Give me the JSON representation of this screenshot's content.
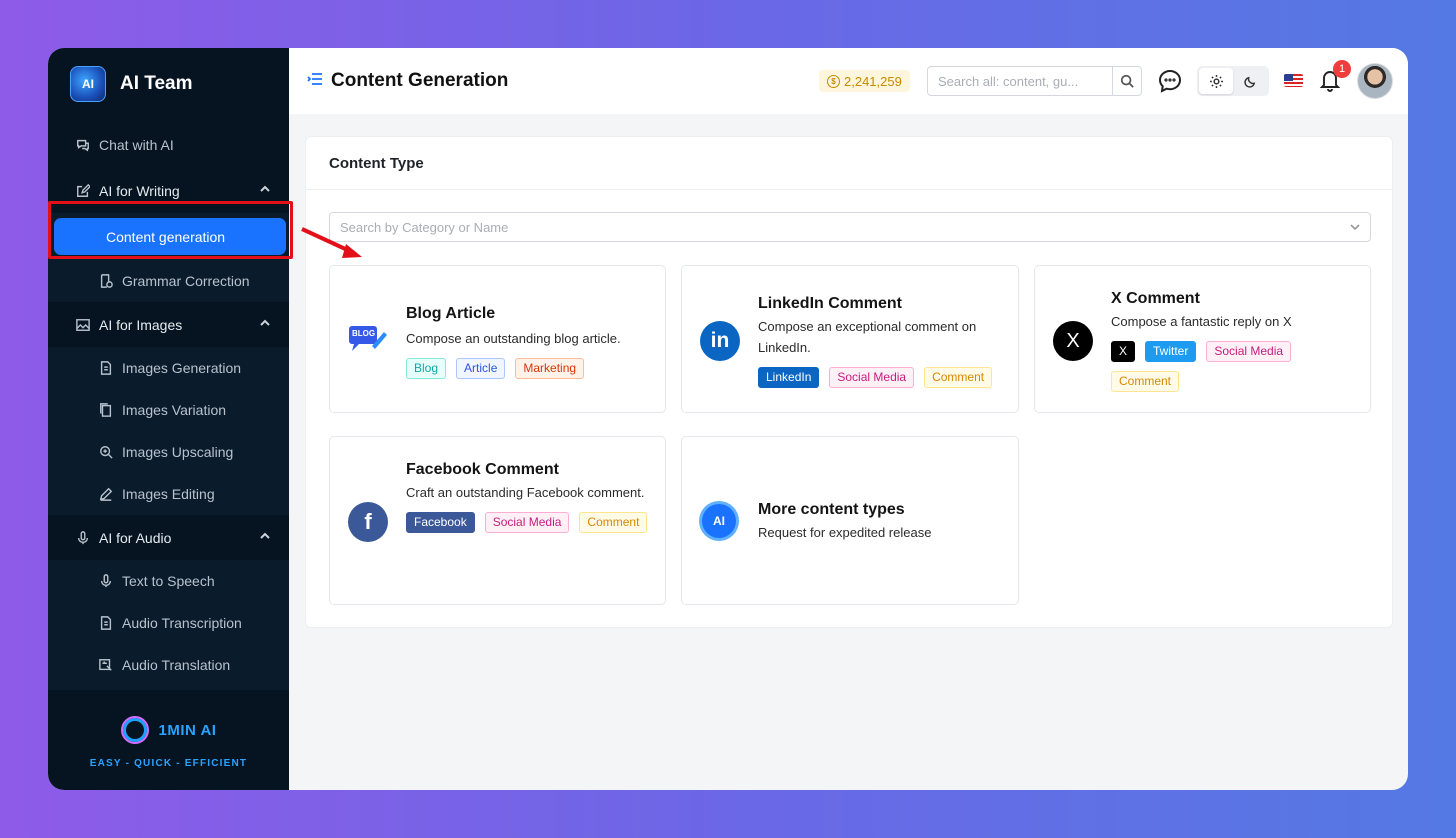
{
  "app": {
    "name": "AI Team",
    "logo_text": "AI"
  },
  "sidebar": {
    "items": [
      {
        "label": "Chat with AI",
        "icon": "chat-bubbles-icon"
      },
      {
        "label": "AI for Writing",
        "icon": "edit-icon",
        "group": true
      },
      {
        "label": "Content generation",
        "icon": "document-icon",
        "active": true
      },
      {
        "label": "Grammar Correction",
        "icon": "grammar-icon"
      },
      {
        "label": "AI for Images",
        "icon": "image-icon",
        "group": true
      },
      {
        "label": "Images Generation",
        "icon": "document-icon"
      },
      {
        "label": "Images Variation",
        "icon": "copy-icon"
      },
      {
        "label": "Images Upscaling",
        "icon": "zoom-in-icon"
      },
      {
        "label": "Images Editing",
        "icon": "pencil-icon"
      },
      {
        "label": "AI for Audio",
        "icon": "microphone-icon",
        "group": true
      },
      {
        "label": "Text to Speech",
        "icon": "microphone-icon"
      },
      {
        "label": "Audio Transcription",
        "icon": "document-icon"
      },
      {
        "label": "Audio Translation",
        "icon": "translate-icon"
      }
    ],
    "footer": {
      "name": "1MIN AI",
      "tagline": "EASY - QUICK - EFFICIENT"
    }
  },
  "header": {
    "title": "Content Generation",
    "credits": "2,241,259",
    "search_placeholder": "Search all: content, gu...",
    "notification_count": "1"
  },
  "panel": {
    "title": "Content Type",
    "search_placeholder": "Search by Category or Name",
    "cards": [
      {
        "title": "Blog Article",
        "desc": "Compose an outstanding blog article.",
        "icon_text": "BLOG",
        "tags": [
          "Blog",
          "Article",
          "Marketing"
        ]
      },
      {
        "title": "LinkedIn Comment",
        "desc": "Compose an exceptional comment on LinkedIn.",
        "icon_text": "in",
        "tags": [
          "LinkedIn",
          "Social Media",
          "Comment"
        ]
      },
      {
        "title": "X Comment",
        "desc": "Compose a fantastic reply on X",
        "icon_text": "X",
        "tags": [
          "X",
          "Twitter",
          "Social Media",
          "Comment"
        ]
      },
      {
        "title": "Facebook Comment",
        "desc": "Craft an outstanding Facebook comment.",
        "icon_text": "f",
        "tags": [
          "Facebook",
          "Social Media",
          "Comment"
        ]
      },
      {
        "title": "More content types",
        "desc": "Request for expedited release",
        "icon_text": "AI",
        "tags": []
      }
    ]
  },
  "colors": {
    "accent": "#1a73ff",
    "sidebar_bg": "#061421",
    "highlight": "#e3101a"
  }
}
